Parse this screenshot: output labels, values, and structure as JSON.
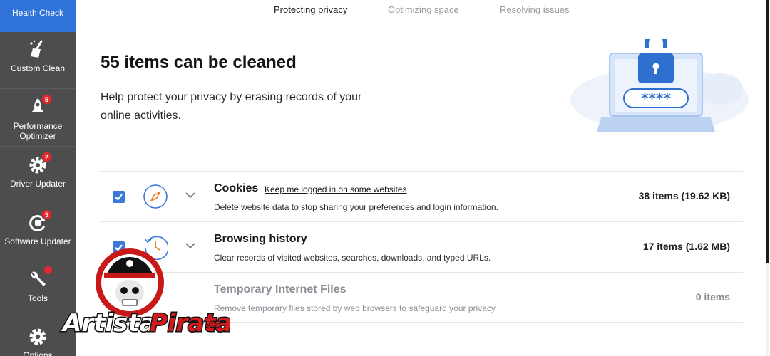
{
  "sidebar": {
    "items": [
      {
        "label": "Health Check",
        "icon": "health-check-icon",
        "active": true
      },
      {
        "label": "Custom Clean",
        "icon": "broom-icon"
      },
      {
        "label": "Performance Optimizer",
        "icon": "rocket-icon",
        "badge": "5"
      },
      {
        "label": "Driver Updater",
        "icon": "gear-icon",
        "badge": "2"
      },
      {
        "label": "Software Updater",
        "icon": "refresh-icon",
        "badge": "5"
      },
      {
        "label": "Tools",
        "icon": "wrench-icon"
      },
      {
        "label": "Options",
        "icon": "settings-icon"
      }
    ]
  },
  "tabs": [
    {
      "label": "Protecting privacy",
      "active": true
    },
    {
      "label": "Optimizing space"
    },
    {
      "label": "Resolving issues"
    }
  ],
  "hero": {
    "title": "55 items can be cleaned",
    "description": "Help protect your privacy by erasing records of your online activities.",
    "password_mask": "****"
  },
  "rows": [
    {
      "title": "Cookies",
      "link": "Keep me logged in on some websites",
      "description": "Delete website data to stop sharing your preferences and login information.",
      "count": "38 items (19.62 KB)",
      "checked": true,
      "icon": "compass-icon"
    },
    {
      "title": "Browsing history",
      "description": "Clear records of visited websites, searches, downloads, and typed URLs.",
      "count": "17 items (1.62 MB)",
      "checked": true,
      "icon": "history-clock-icon"
    },
    {
      "title": "Temporary Internet Files",
      "description": "Remove temporary files stored by web browsers to safeguard your privacy.",
      "count": "0 items",
      "checked": false,
      "icon": "temp-files-icon"
    }
  ],
  "watermark": {
    "text": "ArtistaPirata.es"
  },
  "colors": {
    "sidebar_bg": "#4d4d4d",
    "sidebar_active": "#2f73d8",
    "checkbox": "#3b78d8",
    "badge": "#e8262e",
    "illustration_blue": "#2f6fd0"
  }
}
